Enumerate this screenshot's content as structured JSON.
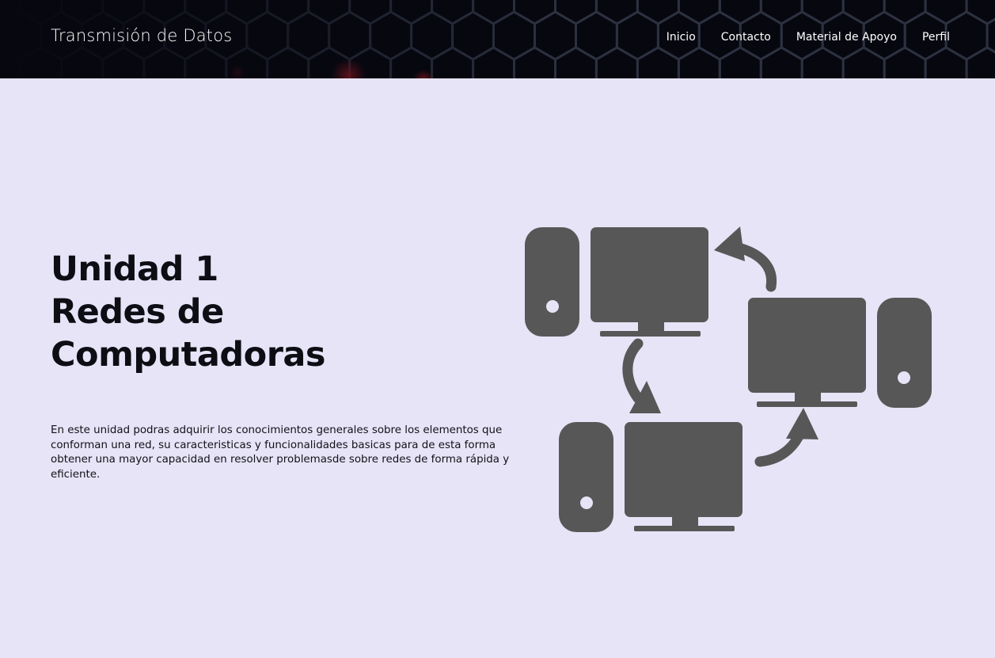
{
  "header": {
    "brand": "Transmisión de Datos",
    "nav": {
      "inicio": "Inicio",
      "contacto": "Contacto",
      "material": "Material de Apoyo",
      "perfil": "Perfil"
    }
  },
  "hero": {
    "title_line1": "Unidad 1",
    "title_line2": "Redes de",
    "title_line3": "Computadoras",
    "description": "En este unidad podras adquirir los conocimientos generales sobre los elementos que conforman una red, su caracteristicas y funcionalidades basicas para de esta forma obtener una mayor capacidad en resolver problemasde sobre redes de forma rápida y eficiente."
  },
  "colors": {
    "page_background": "#e6e4f6",
    "header_background": "#06070f",
    "illustration": "#575757",
    "title_text": "#0d0d14"
  },
  "icons": [
    "hexagon-pattern-background",
    "computer-network-icon"
  ]
}
